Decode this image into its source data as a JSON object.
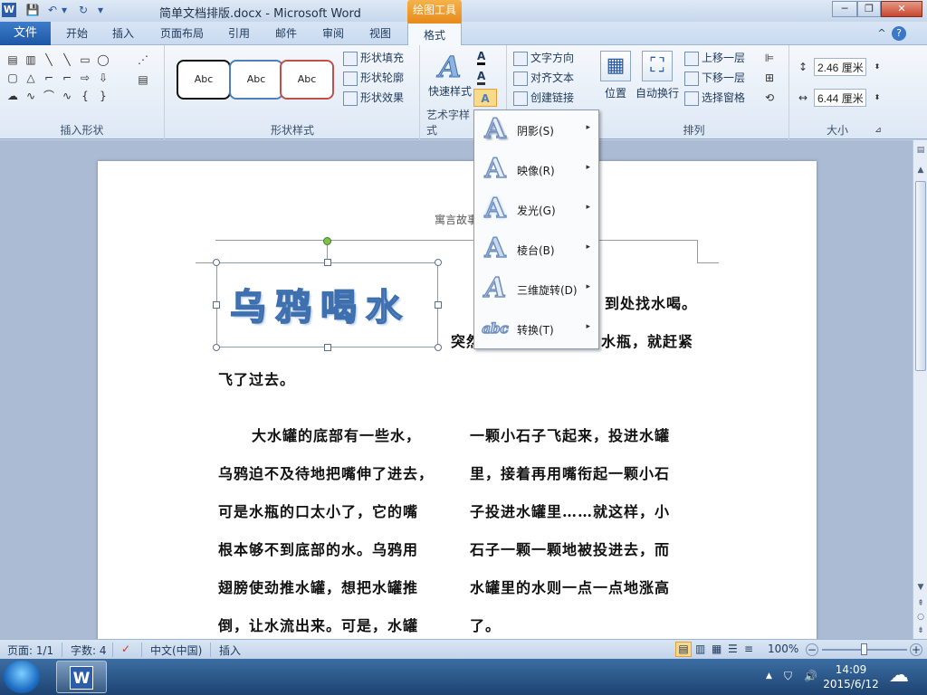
{
  "titlebar": {
    "title": "简单文档排版.docx - Microsoft Word",
    "context_tab_group": "绘图工具",
    "word_icon": "W",
    "qa_save": "💾",
    "qa_undo": "↶",
    "qa_redo": "↻",
    "qa_dropdown": "▾",
    "minimize": "─",
    "restore": "❐",
    "close": "✕"
  },
  "tabs": {
    "file": "文件",
    "items": [
      "开始",
      "插入",
      "页面布局",
      "引用",
      "邮件",
      "审阅",
      "视图",
      "格式"
    ],
    "help": "?",
    "collapse": "^"
  },
  "ribbon": {
    "insert_shapes": {
      "label": "插入形状",
      "shapes": [
        "▤",
        "▥",
        "╲",
        "╲",
        "▭",
        "◯",
        "▢",
        "△",
        "⌐",
        "⌐",
        "⇨",
        "⇩",
        "☁",
        "∿",
        "⌒",
        "∿",
        "{",
        "}"
      ],
      "edit_shape": "⋰",
      "text_box": "▤"
    },
    "shape_styles": {
      "label": "形状样式",
      "presets": [
        "Abc",
        "Abc",
        "Abc"
      ],
      "fill": "形状填充",
      "outline": "形状轮廓",
      "effects": "形状效果"
    },
    "wordart_styles": {
      "label": "艺术字样式",
      "quick_styles": "快速样式",
      "text_fill_glyph": "A",
      "text_outline_glyph": "A",
      "text_effects_glyph": "A"
    },
    "text": {
      "direction": "文字方向",
      "align": "对齐文本",
      "link": "创建链接"
    },
    "arrange": {
      "label": "排列",
      "position": "位置",
      "wrap": "自动换行",
      "bring_forward": "上移一层",
      "send_backward": "下移一层",
      "selection_pane": "选择窗格"
    },
    "size": {
      "label": "大小",
      "height": "2.46 厘米",
      "width": "6.44 厘米"
    }
  },
  "document": {
    "header": "寓言故事",
    "wordart": "乌鸦喝水",
    "lines_right_top": [
      "到处找水喝。",
      "水瓶，就赶紧"
    ],
    "line_partial_left": "突然",
    "line_fly": "飞了过去。",
    "col1": [
      "大水罐的底部有一些水，",
      "乌鸦迫不及待地把嘴伸了进去，",
      "可是水瓶的口太小了，它的嘴",
      "根本够不到底部的水。乌鸦用",
      "翅膀使劲推水罐，想把水罐推",
      "倒，让水流出来。可是，水罐"
    ],
    "col2": [
      "一颗小石子飞起来，投进水罐",
      "里，接着再用嘴衔起一颗小石",
      "子投进水罐里……就这样，小",
      "石子一颗一颗地被投进去，而",
      "水罐里的水则一点一点地涨高",
      "了。"
    ]
  },
  "effects_menu": {
    "items": [
      {
        "label": "阴影(S)",
        "glyph": "A"
      },
      {
        "label": "映像(R)",
        "glyph": "A"
      },
      {
        "label": "发光(G)",
        "glyph": "A"
      },
      {
        "label": "棱台(B)",
        "glyph": "A"
      },
      {
        "label": "三维旋转(D)",
        "glyph": "A"
      },
      {
        "label": "转换(T)",
        "glyph": "abc"
      }
    ],
    "arrow": "▸"
  },
  "statusbar": {
    "page": "页面: 1/1",
    "words": "字数: 4",
    "language": "中文(中国)",
    "mode": "插入",
    "zoom": "100%",
    "zoom_minus": "−",
    "zoom_plus": "+"
  },
  "taskbar": {
    "word_icon": "W",
    "time": "14:09",
    "date": "2015/6/12",
    "tray_up": "▲",
    "tray_flag": "⛉",
    "tray_volume": "🔊",
    "weather": "☁"
  },
  "colors": {
    "accent": "#2b579a",
    "context_tab": "#e88c1e",
    "wordart_fill": "#7ea6d6"
  }
}
